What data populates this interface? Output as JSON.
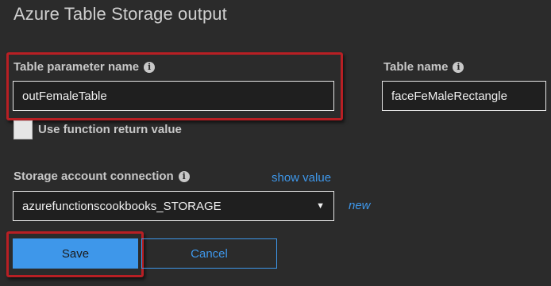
{
  "panel": {
    "title": "Azure Table Storage output"
  },
  "table_parameter": {
    "label": "Table parameter name",
    "value": "outFemaleTable"
  },
  "table_name": {
    "label": "Table name",
    "value": "faceFeMaleRectangle"
  },
  "return_value": {
    "label": "Use function return value",
    "checked": false
  },
  "storage_connection": {
    "label": "Storage account connection",
    "show_value_link": "show value",
    "selected": "azurefunctionscookbooks_STORAGE",
    "new_link": "new"
  },
  "actions": {
    "save_label": "Save",
    "cancel_label": "Cancel"
  },
  "colors": {
    "background": "#2b2b2b",
    "accent": "#3e97ea",
    "highlight": "#b81f24"
  },
  "icons": {
    "info": "info-icon",
    "dropdown": "triangle-down-icon"
  }
}
